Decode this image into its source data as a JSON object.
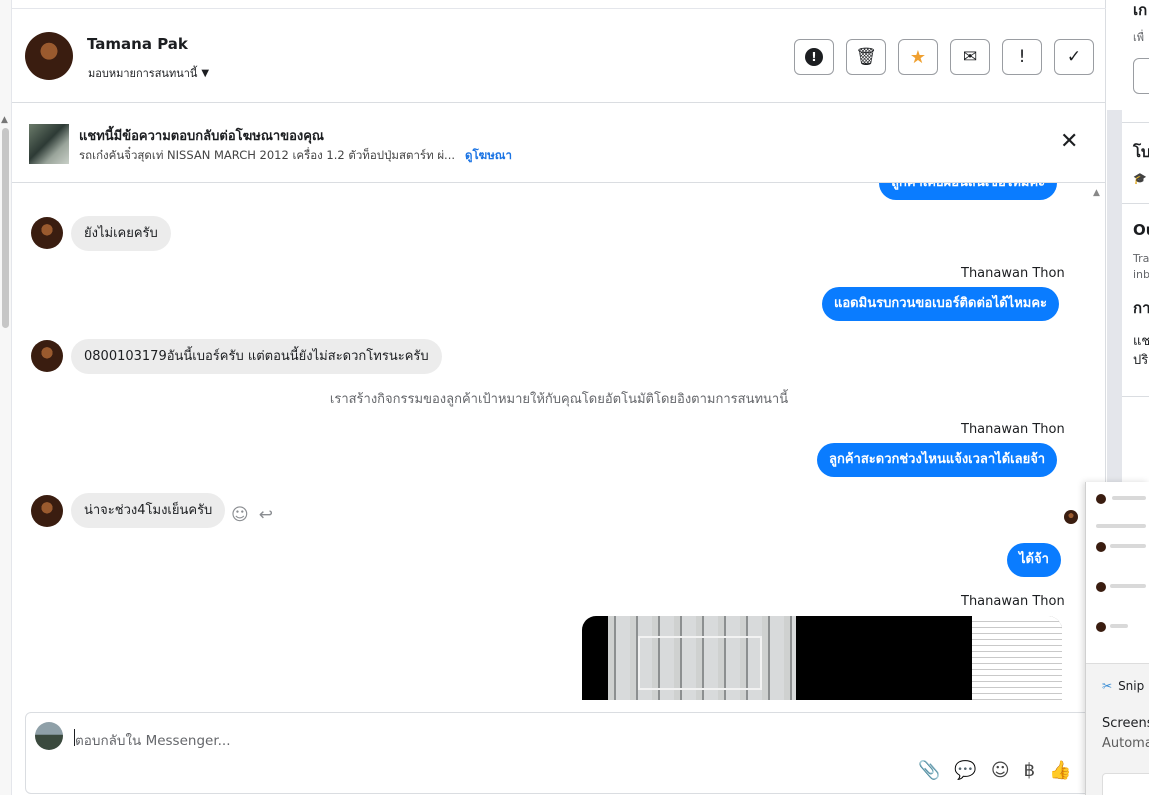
{
  "header": {
    "contact_name": "Tamana Pak",
    "assign_label": "มอบหมายการสนทนานี้",
    "tools": [
      {
        "name": "spam",
        "glyph": "!"
      },
      {
        "name": "delete",
        "glyph": "🗑"
      },
      {
        "name": "star",
        "glyph": "★"
      },
      {
        "name": "mark-unread",
        "glyph": "✉"
      },
      {
        "name": "follow-up",
        "glyph": "!"
      },
      {
        "name": "done",
        "glyph": "✓"
      }
    ]
  },
  "ad_banner": {
    "title": "แชทนี้มีข้อความตอบกลับต่อโฆษณาของคุณ",
    "description": "รถเก๋งคันจิ๋วสุดเท่ NISSAN MARCH 2012 เครื่อง 1.2 ตัวท็อปปุ่มสตาร์ท ผ่...",
    "link": "ดูโฆษณา",
    "close": "✕"
  },
  "messages": {
    "partial_top": "ลูกค้าเคยผ่อนสินเชื่อไหมคะ",
    "m1": "ยังไม่เคยครับ",
    "sender1": "Thanawan Thon",
    "m2": "แอดมินรบกวนขอเบอร์ติดต่อได้ไหมคะ",
    "m3": "0800103179อันนี้เบอร์ครับ แต่ตอนนี้ยังไม่สะดวกโทรนะครับ",
    "system_note": "เราสร้างกิจกรรมของลูกค้าเป้าหมายให้กับคุณโดยอัตโนมัติโดยอิงตามการสนทนานี้",
    "sender2": "Thanawan Thon",
    "m4": "ลูกค้าสะดวกช่วงไหนแจ้งเวลาได้เลยจ้า",
    "m5": "น่าจะช่วง4โมงเย็นครับ",
    "m6": "ได้จ้า",
    "sender3": "Thanawan Thon"
  },
  "composer": {
    "placeholder": "ตอบกลับใน Messenger...",
    "actions": [
      "📎",
      "💬",
      "☺",
      "฿",
      "👍"
    ]
  },
  "right_panel": {
    "section1_title": "เก",
    "section1_sub": "เพื่",
    "section2_title": "โบ",
    "section3_title": "Ou",
    "section3_line1": "Tra",
    "section3_line2": "inb",
    "section4_title": "กา",
    "section4_line1": "แช",
    "section4_line2": "ปริ"
  },
  "snip_popup": {
    "app_name": "Snip",
    "title": "Screens",
    "subtitle": "Automa"
  }
}
